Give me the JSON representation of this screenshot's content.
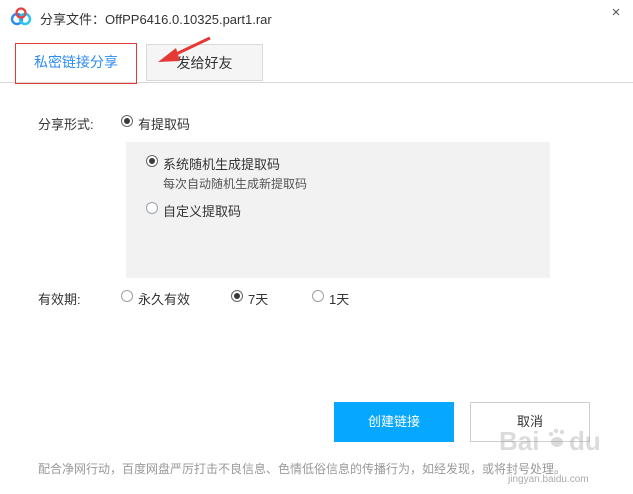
{
  "window": {
    "title": "分享文件：OffPP6416.0.10325.part1.rar",
    "close_glyph": "×"
  },
  "tabs": [
    {
      "label": "私密链接分享",
      "active": true
    },
    {
      "label": "发给好友",
      "active": false
    }
  ],
  "share_form": {
    "label": "分享形式:",
    "option_label": "有提取码",
    "checked": true
  },
  "code_options": [
    {
      "label": "系统随机生成提取码",
      "description": "每次自动随机生成新提取码",
      "checked": true
    },
    {
      "label": "自定义提取码",
      "checked": false
    }
  ],
  "validity": {
    "label": "有效期:",
    "options": [
      {
        "label": "永久有效",
        "checked": false
      },
      {
        "label": "7天",
        "checked": true
      },
      {
        "label": "1天",
        "checked": false
      }
    ]
  },
  "buttons": {
    "create": "创建链接",
    "cancel": "取消"
  },
  "notice": "配合净网行动，百度网盘严厉打击不良信息、色情低俗信息的传播行为，如经发现，或将封号处理。",
  "watermark": "Bai du 经验",
  "watermark_url": "jingyan.baidu.com",
  "colors": {
    "accent": "#06a7ff",
    "tab_active_text": "#2d8cf0",
    "annotation": "#e53935"
  }
}
